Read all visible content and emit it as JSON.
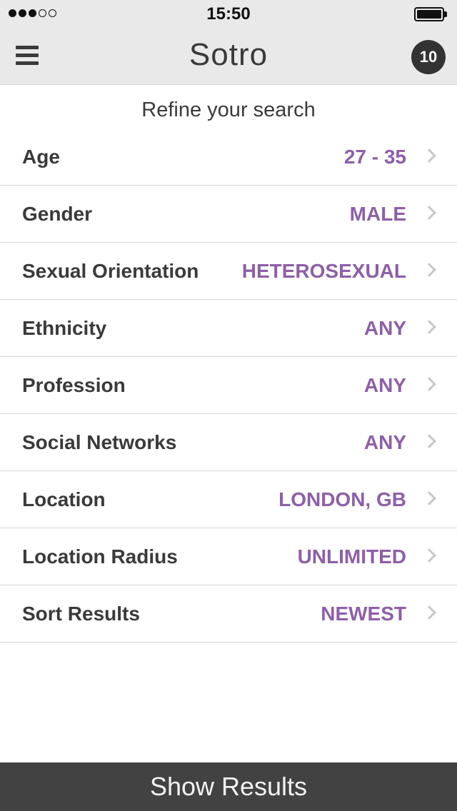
{
  "status_bar": {
    "time": "15:50",
    "signal_filled": 3,
    "signal_total": 5,
    "battery_level": 1.0
  },
  "header": {
    "title": "Sotro",
    "badge_count": "10",
    "menu_icon": "hamburger-menu-icon"
  },
  "main": {
    "subtitle": "Refine your search",
    "filters": [
      {
        "label": "Age",
        "value": "27 - 35"
      },
      {
        "label": "Gender",
        "value": "MALE"
      },
      {
        "label": "Sexual Orientation",
        "value": "HETEROSEXUAL"
      },
      {
        "label": "Ethnicity",
        "value": "ANY"
      },
      {
        "label": "Profession",
        "value": "ANY"
      },
      {
        "label": "Social Networks",
        "value": "ANY"
      },
      {
        "label": "Location",
        "value": "LONDON, GB"
      },
      {
        "label": "Location Radius",
        "value": "UNLIMITED"
      },
      {
        "label": "Sort Results",
        "value": "NEWEST"
      }
    ]
  },
  "footer": {
    "button_label": "Show Results"
  },
  "colors": {
    "accent": "#8e5fa8",
    "nav_background": "#e9e9e9",
    "footer_background": "#424242",
    "text": "#3a3a3a"
  }
}
